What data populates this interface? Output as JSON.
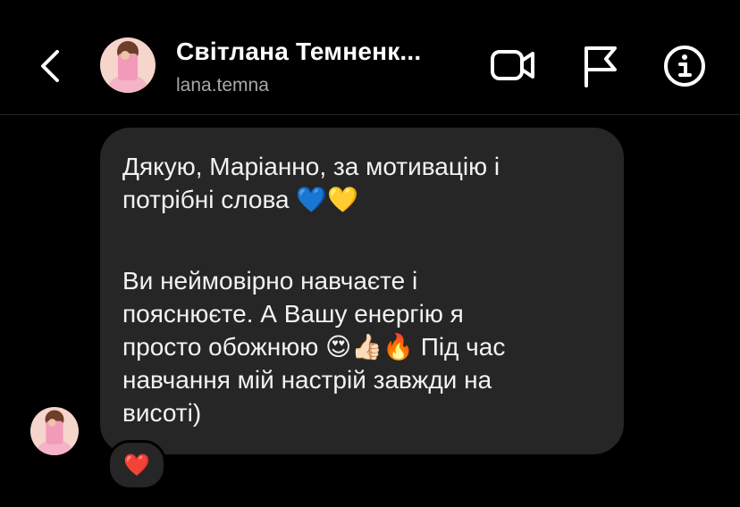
{
  "header": {
    "title": "Світлана Темненк...",
    "username": "lana.temna",
    "icons": [
      "back-chevron-icon",
      "video-call-icon",
      "flag-icon",
      "info-icon"
    ]
  },
  "message": {
    "paragraph_1": "Дякую, Маріанно, за мотивацію і\nпотрібні слова 💙💛",
    "paragraph_2": "Ви неймовірно навчаєте і\nпояснюєте. А Вашу енергію я\nпросто обожнюю 😍👍🏻🔥 Під час\nнавчання мій настрій завжди на\nвисоті)",
    "reaction": "❤️"
  },
  "colors": {
    "background": "#000000",
    "bubble": "#262626",
    "subtitle": "#a8a8a8",
    "avatar_bg": "#f6d5cc"
  }
}
